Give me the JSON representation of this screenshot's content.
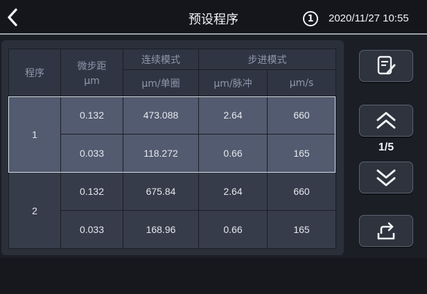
{
  "header": {
    "title": "预设程序",
    "user_number": "1",
    "datetime": "2020/11/27 10:55"
  },
  "table": {
    "col_program": "程序",
    "col_microstep": "微步距",
    "col_microstep_unit": "μm",
    "group_continuous": "连续模式",
    "col_continuous_per_turn": "μm/单圈",
    "group_step": "步进模式",
    "col_step_per_pulse": "μm/脉冲",
    "col_step_speed": "μm/s",
    "programs": [
      {
        "id": "1",
        "selected": true,
        "rows": [
          {
            "microstep": "0.132",
            "per_turn": "473.088",
            "per_pulse": "2.64",
            "speed": "660"
          },
          {
            "microstep": "0.033",
            "per_turn": "118.272",
            "per_pulse": "0.66",
            "speed": "165"
          }
        ]
      },
      {
        "id": "2",
        "selected": false,
        "rows": [
          {
            "microstep": "0.132",
            "per_turn": "675.84",
            "per_pulse": "2.64",
            "speed": "660"
          },
          {
            "microstep": "0.033",
            "per_turn": "168.96",
            "per_pulse": "0.66",
            "speed": "165"
          }
        ]
      }
    ]
  },
  "pagination": {
    "page_indicator": "1/5"
  },
  "icons": {
    "back": "chevron-left-icon",
    "edit": "edit-note-icon",
    "up": "double-chevron-up-icon",
    "down": "double-chevron-down-icon",
    "export": "export-icon"
  },
  "colors": {
    "background": "#1b1e25",
    "panel": "#2a2f3a",
    "header_text": "#8f98ad",
    "cell": "#363c4a",
    "selected_cell": "#525b6f",
    "selection_border": "#d8dce4"
  }
}
